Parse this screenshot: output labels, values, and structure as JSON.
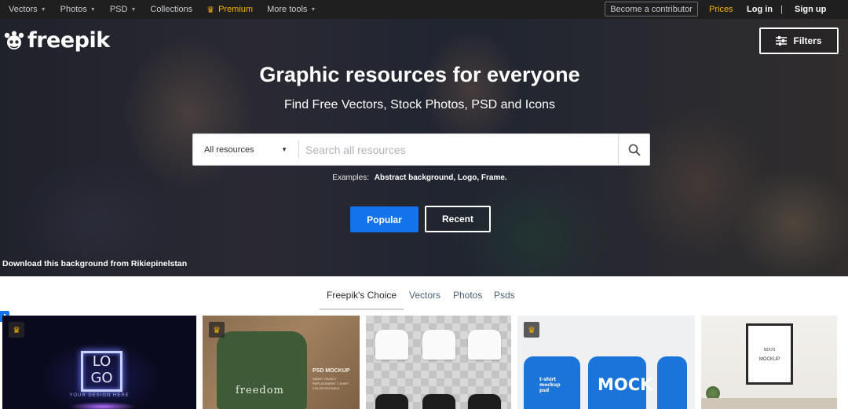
{
  "topnav": {
    "items": [
      {
        "label": "Vectors",
        "has_caret": true
      },
      {
        "label": "Photos",
        "has_caret": true
      },
      {
        "label": "PSD",
        "has_caret": true
      },
      {
        "label": "Collections",
        "has_caret": false
      }
    ],
    "premium": "Premium",
    "more_tools": "More tools",
    "contributor": "Become a contributor",
    "prices": "Prices",
    "login": "Log in",
    "separator": "|",
    "signup": "Sign up"
  },
  "hero": {
    "logo_text": "freepik",
    "filters_label": "Filters",
    "title": "Graphic resources for everyone",
    "subtitle": "Find Free Vectors, Stock Photos, PSD and Icons",
    "search": {
      "category": "All resources",
      "placeholder": "Search all resources"
    },
    "examples_label": "Examples:",
    "examples_value": "Abstract background, Logo, Frame.",
    "popular_label": "Popular",
    "recent_label": "Recent",
    "credit": "Download this background from Rikiepinelstan"
  },
  "tabs": [
    {
      "label": "Freepik's Choice",
      "active": true
    },
    {
      "label": "Vectors",
      "active": false
    },
    {
      "label": "Photos",
      "active": false
    },
    {
      "label": "Psds",
      "active": false
    }
  ],
  "cards": {
    "card1": {
      "logo": "LO GO",
      "caption": "YOUR DESIGN HERE"
    },
    "card2": {
      "shirt_text": "freedom",
      "title": "PSD MOCKUP",
      "small": "SMART OBJECT REPLACEMENT T-SHIRT COLOR EDITABLE"
    },
    "card4": {
      "text_a": "t-shirt mockup psd",
      "text_b": "MOCK"
    },
    "card5": {
      "size": "50X70",
      "label": "MOCKUP"
    }
  },
  "colors": {
    "accent": "#1273eb",
    "premium": "#f7b500",
    "topbar": "#1f1f1f"
  }
}
